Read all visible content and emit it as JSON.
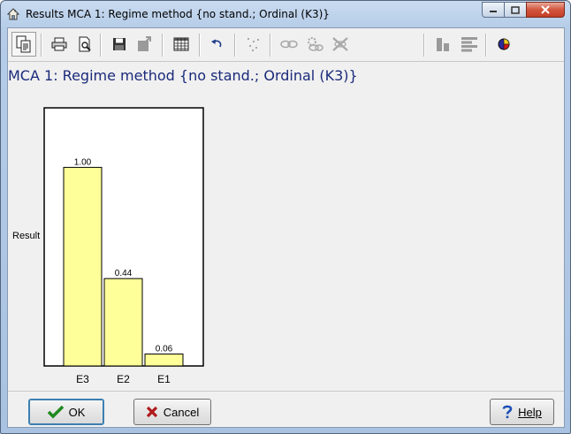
{
  "window": {
    "title": "Results MCA 1: Regime method {no stand.; Ordinal (K3)}",
    "controls": [
      "minimize-icon",
      "maximize-icon",
      "close-icon"
    ]
  },
  "toolbar": {
    "buttons": [
      {
        "name": "copy-results-button",
        "icon": "clipboard-icon",
        "enabled": true,
        "selected": true
      },
      {
        "name": "print-button",
        "icon": "printer-icon",
        "enabled": true
      },
      {
        "name": "print-preview-button",
        "icon": "print-preview-icon",
        "enabled": true
      },
      {
        "name": "save-button",
        "icon": "floppy-disk-icon",
        "enabled": true
      },
      {
        "name": "export-button",
        "icon": "export-icon",
        "enabled": false
      },
      {
        "name": "table-button",
        "icon": "table-grid-icon",
        "enabled": true
      },
      {
        "name": "undo-button",
        "icon": "undo-arrow-icon",
        "enabled": true
      },
      {
        "name": "scatter-button",
        "icon": "scatter-dots-icon",
        "enabled": false
      },
      {
        "name": "link-button",
        "icon": "link-icon",
        "enabled": false
      },
      {
        "name": "link-settings-button",
        "icon": "link-gear-icon",
        "enabled": false
      },
      {
        "name": "delete-link-button",
        "icon": "delete-cross-icon",
        "enabled": false
      },
      {
        "name": "bar-chart-button",
        "icon": "bar-chart-icon",
        "enabled": false
      },
      {
        "name": "row-chart-button",
        "icon": "row-chart-icon",
        "enabled": false
      },
      {
        "name": "pie-chart-button",
        "icon": "pie-chart-icon",
        "enabled": true
      }
    ]
  },
  "colors": {
    "bar_fill": "#ffff99",
    "title_text": "#1a2a7a",
    "ok_check": "#1f8a1f",
    "cancel_x": "#b01a1a",
    "help_q": "#1a4fb8"
  },
  "chart_data": {
    "type": "bar",
    "title": "MCA 1: Regime method {no stand.; Ordinal (K3)}",
    "ylabel": "Result",
    "xlabel": "",
    "categories": [
      "E3",
      "E2",
      "E1"
    ],
    "values": [
      1.0,
      0.44,
      0.06
    ],
    "value_labels": [
      "1.00",
      "0.44",
      "0.06"
    ],
    "ylim": [
      0,
      1.3
    ],
    "grid": false,
    "legend": "none"
  },
  "footer": {
    "ok_label": "OK",
    "cancel_label": "Cancel",
    "help_label": "Help"
  }
}
